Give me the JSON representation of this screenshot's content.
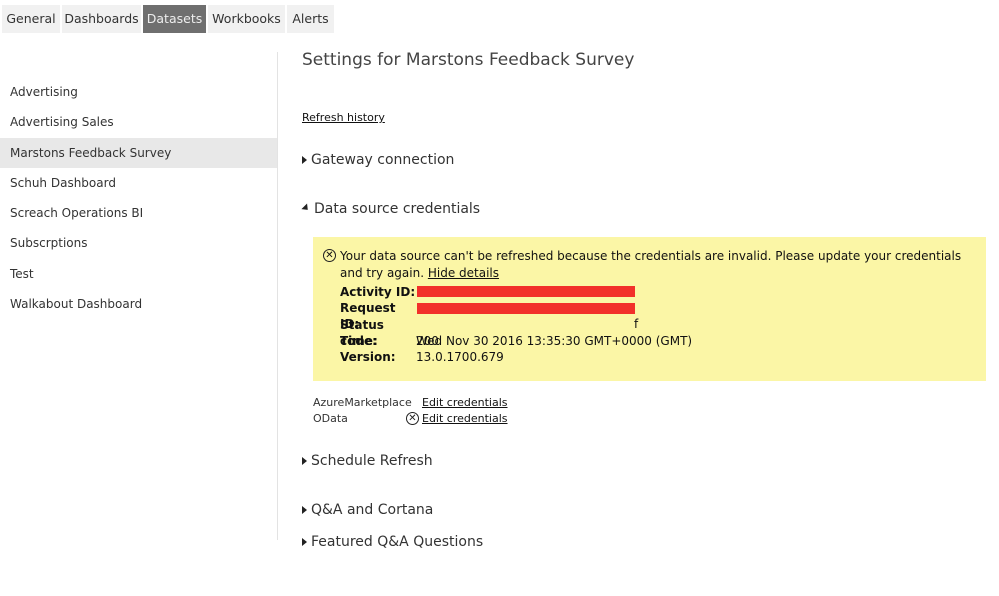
{
  "tabs": [
    {
      "label": "General"
    },
    {
      "label": "Dashboards"
    },
    {
      "label": "Datasets",
      "active": true
    },
    {
      "label": "Workbooks"
    },
    {
      "label": "Alerts"
    }
  ],
  "sidebar": {
    "items": [
      "Advertising",
      "Advertising Sales",
      "Marstons Feedback Survey",
      "Schuh Dashboard",
      "Screach Operations BI",
      "Subscrptions",
      "Test",
      "Walkabout Dashboard"
    ],
    "selected": "Marstons Feedback Survey"
  },
  "main": {
    "title": "Settings for Marstons Feedback Survey",
    "refresh_history": "Refresh history",
    "sections": {
      "gateway": "Gateway connection",
      "credentials": "Data source credentials",
      "schedule": "Schedule Refresh",
      "qna": "Q&A and Cortana",
      "featured": "Featured Q&A Questions"
    },
    "alert": {
      "message": "Your data source can't be refreshed because the credentials are invalid. Please update your credentials and try again.",
      "hide_details": "Hide details",
      "activity_label": "Activity ID:",
      "request_label": "Request ID:",
      "request_tail": "f",
      "status_label": "Status code:",
      "status_value": "200",
      "time_label": "Time:",
      "time_value": "Wed Nov 30 2016 13:35:30 GMT+0000 (GMT)",
      "version_label": "Version:",
      "version_value": "13.0.1700.679",
      "background": "#fbf6a6",
      "redaction_color": "#f2302a"
    },
    "datasources": [
      {
        "name": "AzureMarketplace",
        "action": "Edit credentials",
        "error": false
      },
      {
        "name": "OData",
        "action": "Edit credentials",
        "error": true
      }
    ]
  }
}
